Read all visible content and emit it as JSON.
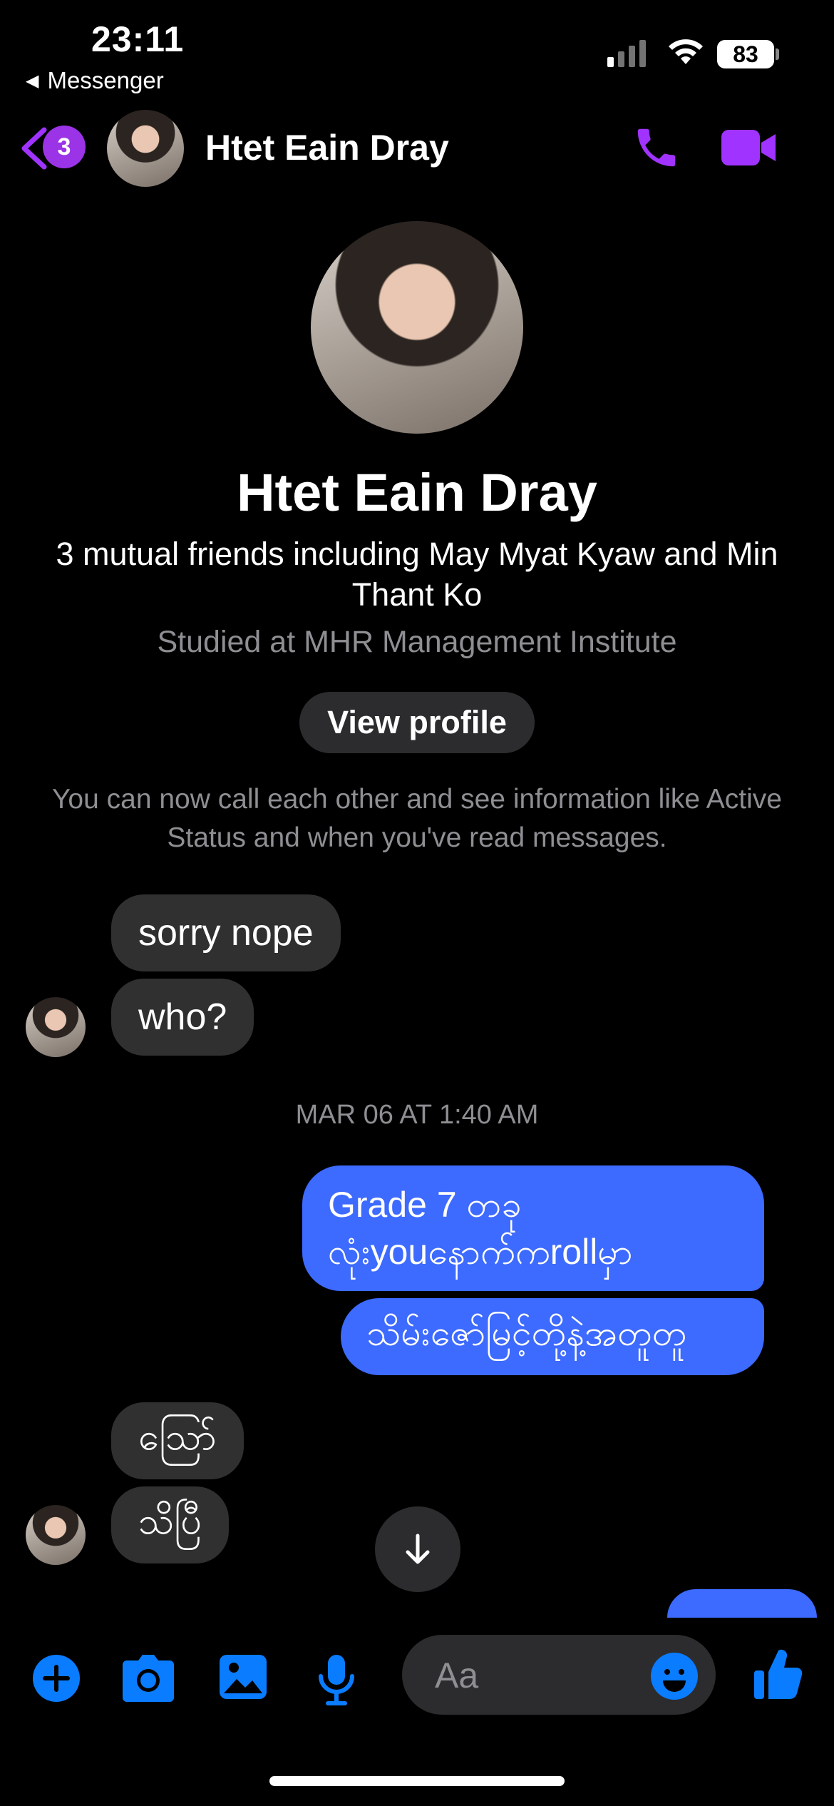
{
  "status_bar": {
    "time": "23:11",
    "back_app_label": "Messenger",
    "battery": "83"
  },
  "header": {
    "unread_count": "3",
    "contact_name": "Htet Eain Dray"
  },
  "profile": {
    "name": "Htet Eain Dray",
    "mutual_friends": "3 mutual friends including May Myat Kyaw and Min Thant Ko",
    "education": "Studied at MHR Management Institute",
    "view_profile_label": "View profile",
    "notice": "You can now call each other and see information like Active Status and when you've read messages."
  },
  "messages": [
    {
      "from": "them",
      "text": "sorry nope"
    },
    {
      "from": "them",
      "text": "who?"
    },
    {
      "type": "timestamp",
      "text": "MAR 06 AT 1:40 AM"
    },
    {
      "from": "me",
      "text": "Grade 7 တခု\nလုံးyouနောက်ကrollမှာ"
    },
    {
      "from": "me",
      "text": "သိမ်းဇော်မြင့်တို့နဲ့အတူတူ"
    },
    {
      "from": "them",
      "text": "သြော်"
    },
    {
      "from": "them",
      "text": "သိပြီ"
    }
  ],
  "composer": {
    "placeholder": "Aa"
  },
  "colors": {
    "accent_purple": "#a033ff",
    "accent_blue": "#0a7cff",
    "outgoing_bubble": "#3d6aff",
    "incoming_bubble": "#303030"
  }
}
